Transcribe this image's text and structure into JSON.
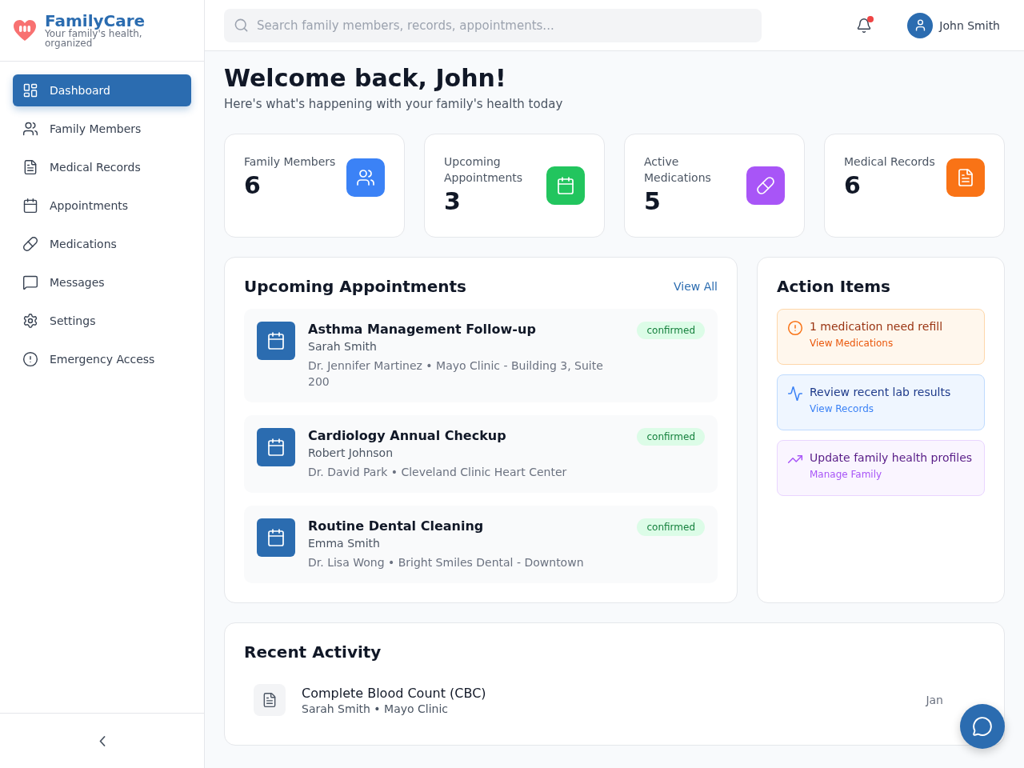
{
  "brand": {
    "name": "FamilyCare",
    "tagline": "Your family's health, organized"
  },
  "sidebar": {
    "items": [
      {
        "label": "Dashboard",
        "selected": true
      },
      {
        "label": "Family Members",
        "selected": false
      },
      {
        "label": "Medical Records",
        "selected": false
      },
      {
        "label": "Appointments",
        "selected": false
      },
      {
        "label": "Medications",
        "selected": false
      },
      {
        "label": "Messages",
        "selected": false
      },
      {
        "label": "Settings",
        "selected": false
      },
      {
        "label": "Emergency Access",
        "selected": false
      }
    ]
  },
  "search": {
    "placeholder": "Search family members, records, appointments..."
  },
  "notifications": {
    "unread": true
  },
  "user": {
    "name": "John Smith"
  },
  "welcome": {
    "title": "Welcome back, John!",
    "subtitle": "Here's what's happening with your family's health today"
  },
  "stats": [
    {
      "label": "Family Members",
      "value": "6",
      "color": "#3b82f6"
    },
    {
      "label": "Upcoming Appointments",
      "value": "3",
      "color": "#22c55e"
    },
    {
      "label": "Active Medications",
      "value": "5",
      "color": "#a855f7"
    },
    {
      "label": "Medical Records",
      "value": "6",
      "color": "#f97316"
    }
  ],
  "appointments": {
    "title": "Upcoming Appointments",
    "link": "View All",
    "items": [
      {
        "title": "Asthma Management Follow-up",
        "patient": "Sarah Smith",
        "details": "Dr. Jennifer Martinez • Mayo Clinic - Building 3, Suite 200",
        "status": "confirmed"
      },
      {
        "title": "Cardiology Annual Checkup",
        "patient": "Robert Johnson",
        "details": "Dr. David Park • Cleveland Clinic Heart Center",
        "status": "confirmed"
      },
      {
        "title": "Routine Dental Cleaning",
        "patient": "Emma Smith",
        "details": "Dr. Lisa Wong • Bright Smiles Dental - Downtown",
        "status": "confirmed"
      }
    ]
  },
  "actions": {
    "title": "Action Items",
    "items": [
      {
        "kind": "warning",
        "text": "1 medication need refill",
        "link": "View Medications"
      },
      {
        "kind": "info",
        "text": "Review recent lab results",
        "link": "View Records"
      },
      {
        "kind": "profile",
        "text": "Update family health profiles",
        "link": "Manage Family"
      }
    ]
  },
  "activity": {
    "title": "Recent Activity",
    "items": [
      {
        "title": "Complete Blood Count (CBC)",
        "meta": "Sarah Smith • Mayo Clinic",
        "date": "Jan"
      }
    ]
  }
}
